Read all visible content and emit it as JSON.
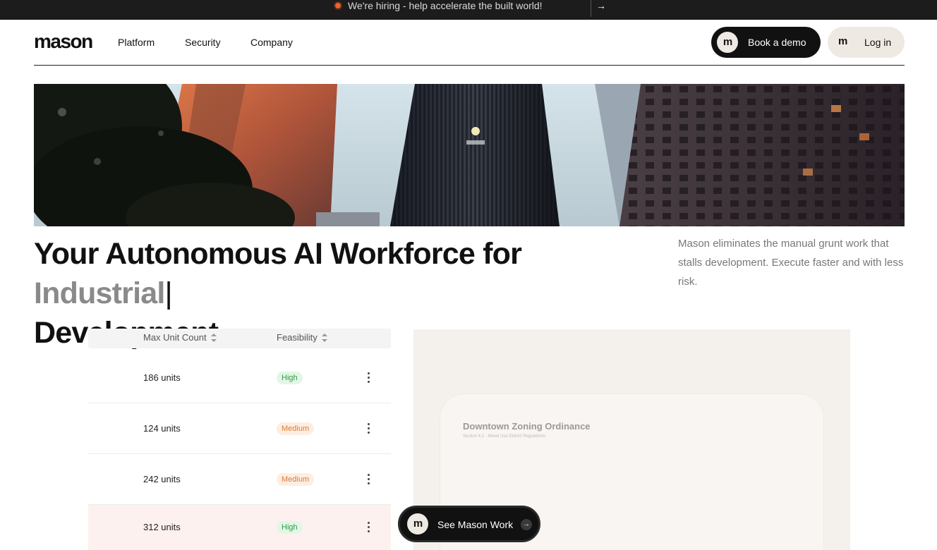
{
  "announcement": {
    "text": "We're hiring - help accelerate the built world!",
    "arrow": "→",
    "dot_color": "#f0602a"
  },
  "brand": {
    "logo": "mason",
    "mark": "m"
  },
  "nav": {
    "links": [
      "Platform",
      "Security",
      "Company"
    ],
    "book_demo": "Book a demo",
    "log_in": "Log in"
  },
  "hero": {
    "headline_prefix": "Your Autonomous AI Workforce for ",
    "headline_accent": "Industrial",
    "headline_caret": "|",
    "headline_suffix": "Development",
    "subcopy": "Mason eliminates the manual grunt work that stalls development. Execute faster and with less risk."
  },
  "table": {
    "headers": [
      "Max Unit Count",
      "Feasibility"
    ],
    "rows": [
      {
        "units": "186 units",
        "feasibility": "High"
      },
      {
        "units": "124 units",
        "feasibility": "Medium"
      },
      {
        "units": "242 units",
        "feasibility": "Medium"
      },
      {
        "units": "312 units",
        "feasibility": "High"
      }
    ]
  },
  "document": {
    "title": "Downtown Zoning Ordinance",
    "subtitle": "Section 4.2 - Mixed Use District Regulations"
  },
  "cta": {
    "label": "See Mason Work",
    "arrow": "→"
  },
  "colors": {
    "accent_dark": "#111111",
    "beige": "#efe9e3",
    "high_text": "#2e9a4a",
    "medium_text": "#e07a2f"
  }
}
